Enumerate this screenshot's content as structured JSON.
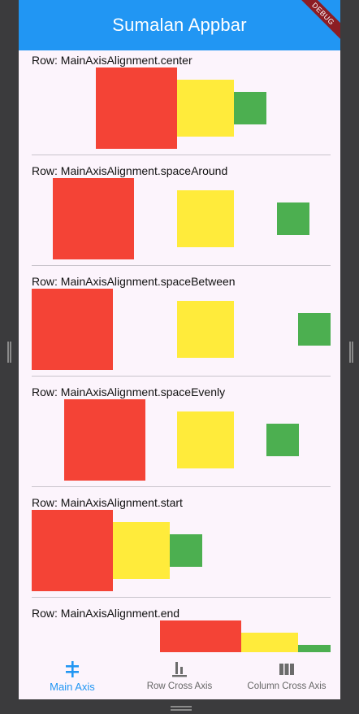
{
  "appbar": {
    "title": "Sumalan Appbar",
    "debug_banner": "DEBUG"
  },
  "sections": [
    {
      "title": "Row: MainAxisAlignment.center"
    },
    {
      "title": "Row: MainAxisAlignment.spaceAround"
    },
    {
      "title": "Row: MainAxisAlignment.spaceBetween"
    },
    {
      "title": "Row: MainAxisAlignment.spaceEvenly"
    },
    {
      "title": "Row: MainAxisAlignment.start"
    },
    {
      "title": "Row: MainAxisAlignment.end"
    }
  ],
  "colors": {
    "appbar": "#2196f3",
    "red": "#f44336",
    "yellow": "#ffeb3b",
    "green": "#4caf50",
    "active": "#2196f3"
  },
  "bottom_nav": {
    "items": [
      {
        "label": "Main Axis",
        "icon": "main-axis-icon",
        "active": true
      },
      {
        "label": "Row Cross Axis",
        "icon": "row-cross-axis-icon",
        "active": false
      },
      {
        "label": "Column Cross Axis",
        "icon": "column-cross-axis-icon",
        "active": false
      }
    ]
  }
}
